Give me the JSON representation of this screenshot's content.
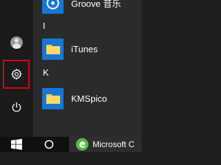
{
  "start_menu": {
    "rail": {
      "user_icon": "user-icon",
      "settings_icon": "gear-icon",
      "power_icon": "power-icon",
      "highlight_color": "#e00012"
    },
    "apps": [
      {
        "type": "app",
        "label": "Groove 音乐",
        "icon": "groove-icon"
      },
      {
        "type": "header",
        "label": "I"
      },
      {
        "type": "app",
        "label": "iTunes",
        "icon": "folder-icon"
      },
      {
        "type": "header",
        "label": "K"
      },
      {
        "type": "app",
        "label": "KMSpico",
        "icon": "folder-icon"
      }
    ]
  },
  "taskbar": {
    "start_icon": "windows-logo-icon",
    "search_icon": "cortana-circle-icon",
    "active_app_label": "Microsoft C",
    "active_app_icon": "edge-icon"
  },
  "colors": {
    "tile_blue": "#1976d2",
    "folder_yellow": "#f6c84a",
    "accent_green": "#58b947"
  }
}
